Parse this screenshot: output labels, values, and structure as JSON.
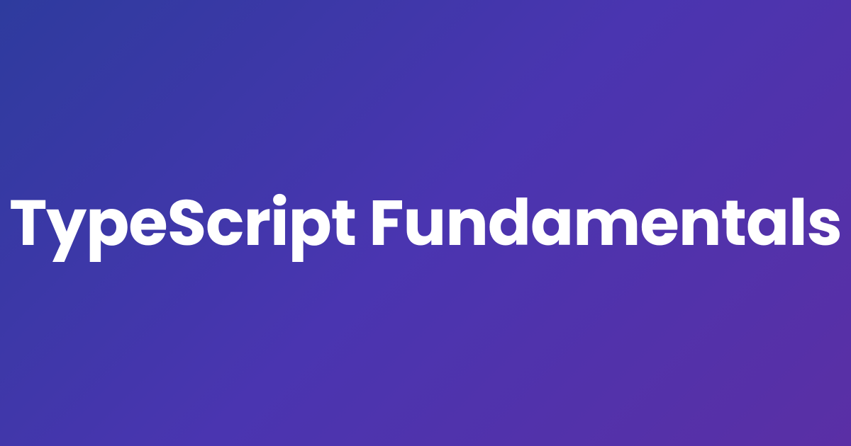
{
  "hero": {
    "title": "TypeScript Fundamentals",
    "gradient_start": "#2e3b9e",
    "gradient_mid": "#4a35b0",
    "gradient_end": "#5a2fa5",
    "text_color": "#ffffff"
  }
}
